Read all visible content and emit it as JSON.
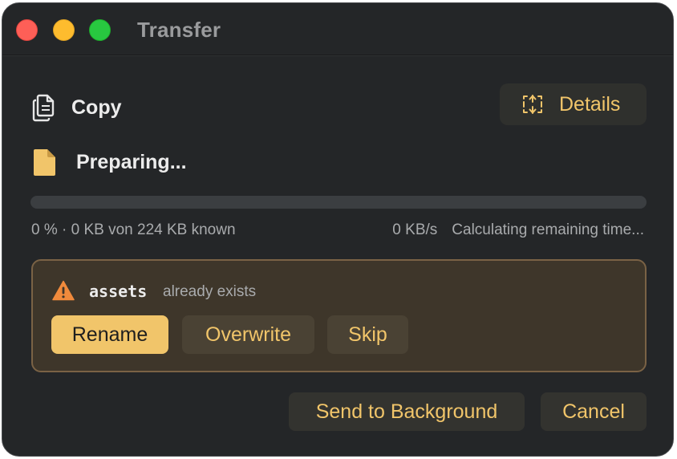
{
  "window": {
    "title": "Transfer",
    "controls": [
      "close",
      "minimize",
      "maximize"
    ]
  },
  "operation": {
    "label": "Copy",
    "icon": "copy-icon"
  },
  "details_button": {
    "label": "Details",
    "icon": "expand-vertical-icon"
  },
  "file": {
    "icon": "document-icon",
    "status": "Preparing..."
  },
  "progress": {
    "fraction": 0.0,
    "summary": "0 % · 0 KB von 224 KB known",
    "speed": "0 KB/s",
    "remaining": "Calculating remaining time..."
  },
  "conflict": {
    "icon": "warning-icon",
    "name": "assets",
    "message": "already exists",
    "actions": {
      "rename": "Rename",
      "overwrite": "Overwrite",
      "skip": "Skip"
    }
  },
  "footer": {
    "background_label": "Send to Background",
    "cancel_label": "Cancel"
  },
  "colors": {
    "accent": "#f1c56a",
    "window_bg": "#242628",
    "conflict_bg": "#3e362a",
    "conflict_border": "#7a6245",
    "warning": "#f08a3c"
  }
}
